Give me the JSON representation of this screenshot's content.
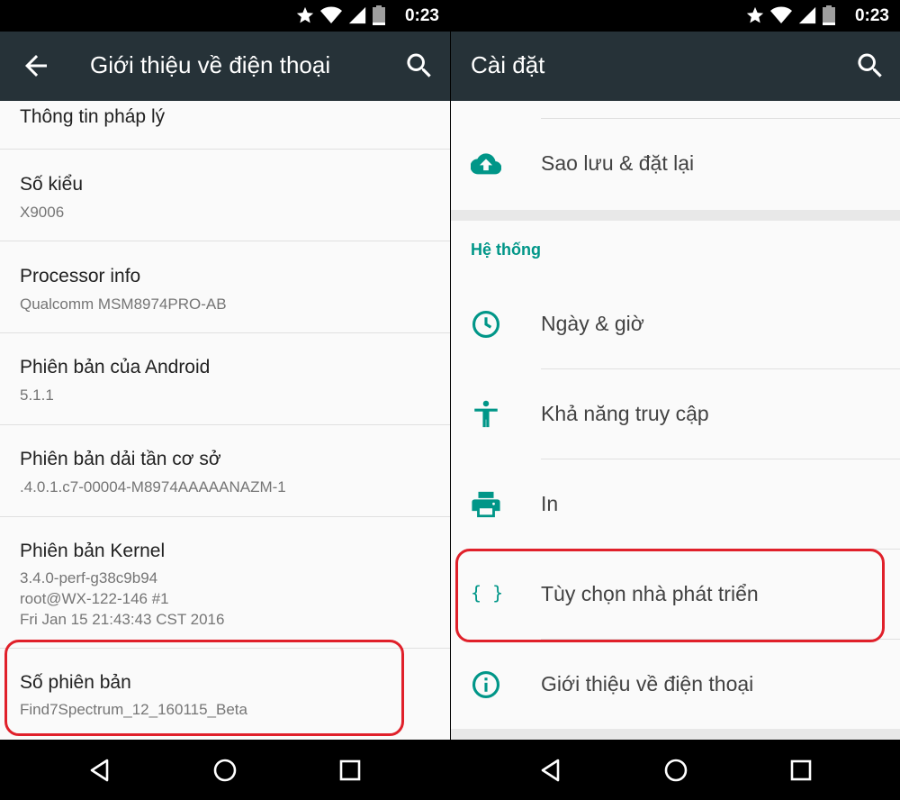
{
  "left": {
    "status_time": "0:23",
    "title": "Giới thiệu về điện thoại",
    "items": [
      {
        "title": "Thông tin pháp lý",
        "sub": []
      },
      {
        "title": "Số kiểu",
        "sub": [
          "X9006"
        ]
      },
      {
        "title": "Processor info",
        "sub": [
          "Qualcomm MSM8974PRO-AB"
        ]
      },
      {
        "title": "Phiên bản của Android",
        "sub": [
          "5.1.1"
        ]
      },
      {
        "title": "Phiên bản dải tần cơ sở",
        "sub": [
          ".4.0.1.c7-00004-M8974AAAAANAZM-1"
        ]
      },
      {
        "title": "Phiên bản Kernel",
        "sub": [
          "3.4.0-perf-g38c9b94",
          "root@WX-122-146 #1",
          "Fri Jan 15 21:43:43 CST 2016"
        ]
      },
      {
        "title": "Số phiên bản",
        "sub": [
          "Find7Spectrum_12_160115_Beta"
        ]
      }
    ]
  },
  "right": {
    "status_time": "0:23",
    "title": "Cài đặt",
    "backup_label": "Sao lưu & đặt lại",
    "section_title": "Hệ thống",
    "items": [
      {
        "icon": "clock-icon",
        "label": "Ngày & giờ"
      },
      {
        "icon": "accessibility-icon",
        "label": "Khả năng truy cập"
      },
      {
        "icon": "printer-icon",
        "label": "In"
      },
      {
        "icon": "braces-icon",
        "label": "Tùy chọn nhà phát triển",
        "braces": "{ }"
      },
      {
        "icon": "info-icon",
        "label": "Giới thiệu về điện thoại"
      }
    ]
  },
  "colors": {
    "appbar": "#263238",
    "accent": "#009688",
    "highlight": "#e0202a"
  }
}
